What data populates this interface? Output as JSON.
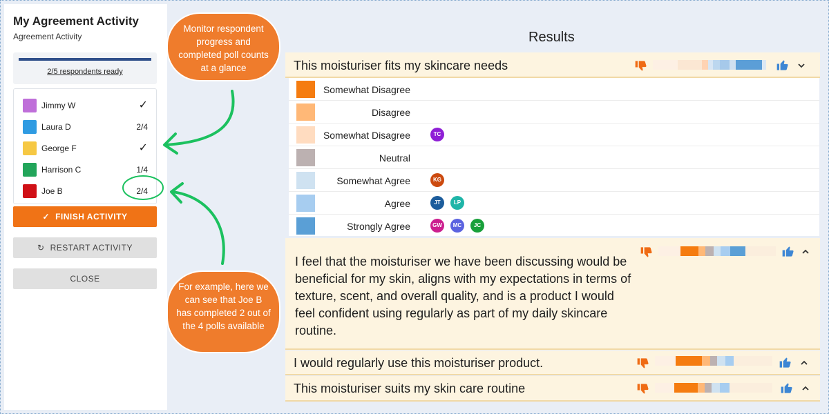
{
  "sidebar": {
    "title": "My Agreement Activity",
    "subtitle": "Agreement Activity",
    "progress_text": "2/5 respondents ready",
    "progress_fraction": 1.0,
    "respondents": [
      {
        "name": "Jimmy W",
        "status": "✓",
        "color": "#bf6fd9"
      },
      {
        "name": "Laura D",
        "status": "2/4",
        "color": "#2f9be2"
      },
      {
        "name": "George F",
        "status": "✓",
        "color": "#f6c843"
      },
      {
        "name": "Harrison C",
        "status": "1/4",
        "color": "#22a55a"
      },
      {
        "name": "Joe B",
        "status": "2/4",
        "color": "#d01016"
      }
    ],
    "finish_label": "FINISH ACTIVITY",
    "restart_label": "RESTART ACTIVITY",
    "close_label": "CLOSE"
  },
  "callouts": {
    "top": "Monitor respondent progress and completed poll counts at a glance",
    "bottom": "For example, here we can see that Joe B has completed 2 out of the 4 polls available"
  },
  "results": {
    "title": "Results",
    "questions": [
      {
        "text": "This moisturiser fits my skincare needs"
      },
      {
        "text": "I feel that the moisturiser we have been discussing would be beneficial for my skin, aligns with my expectations in terms of texture, scent, and overall quality, and is a product I would feel confident using regularly as part of my daily skincare routine."
      },
      {
        "text": "I would regularly use this moisturiser product."
      },
      {
        "text": "This moisturiser suits my skin care routine"
      }
    ],
    "distribution": [
      {
        "label": "Somewhat Disagree",
        "color": "#f57c10",
        "respondents": []
      },
      {
        "label": "Disagree",
        "color": "#ffb877",
        "respondents": []
      },
      {
        "label": "Somewhat Disagree",
        "color": "#ffdcc0",
        "respondents": [
          {
            "initials": "TC",
            "color": "#8f1fd6"
          }
        ]
      },
      {
        "label": "Neutral",
        "color": "#bcb1b1",
        "respondents": []
      },
      {
        "label": "Somewhat Agree",
        "color": "#cfe2f1",
        "respondents": [
          {
            "initials": "KG",
            "color": "#cc4a0f"
          }
        ]
      },
      {
        "label": "Agree",
        "color": "#a7cdf0",
        "respondents": [
          {
            "initials": "JT",
            "color": "#1d5d9c"
          },
          {
            "initials": "LP",
            "color": "#1fb5a8"
          }
        ]
      },
      {
        "label": "Strongly Agree",
        "color": "#5a9fd6",
        "respondents": [
          {
            "initials": "GW",
            "color": "#cc1f8f"
          },
          {
            "initials": "MC",
            "color": "#5b63e0"
          },
          {
            "initials": "JC",
            "color": "#18a03a"
          }
        ]
      }
    ]
  }
}
